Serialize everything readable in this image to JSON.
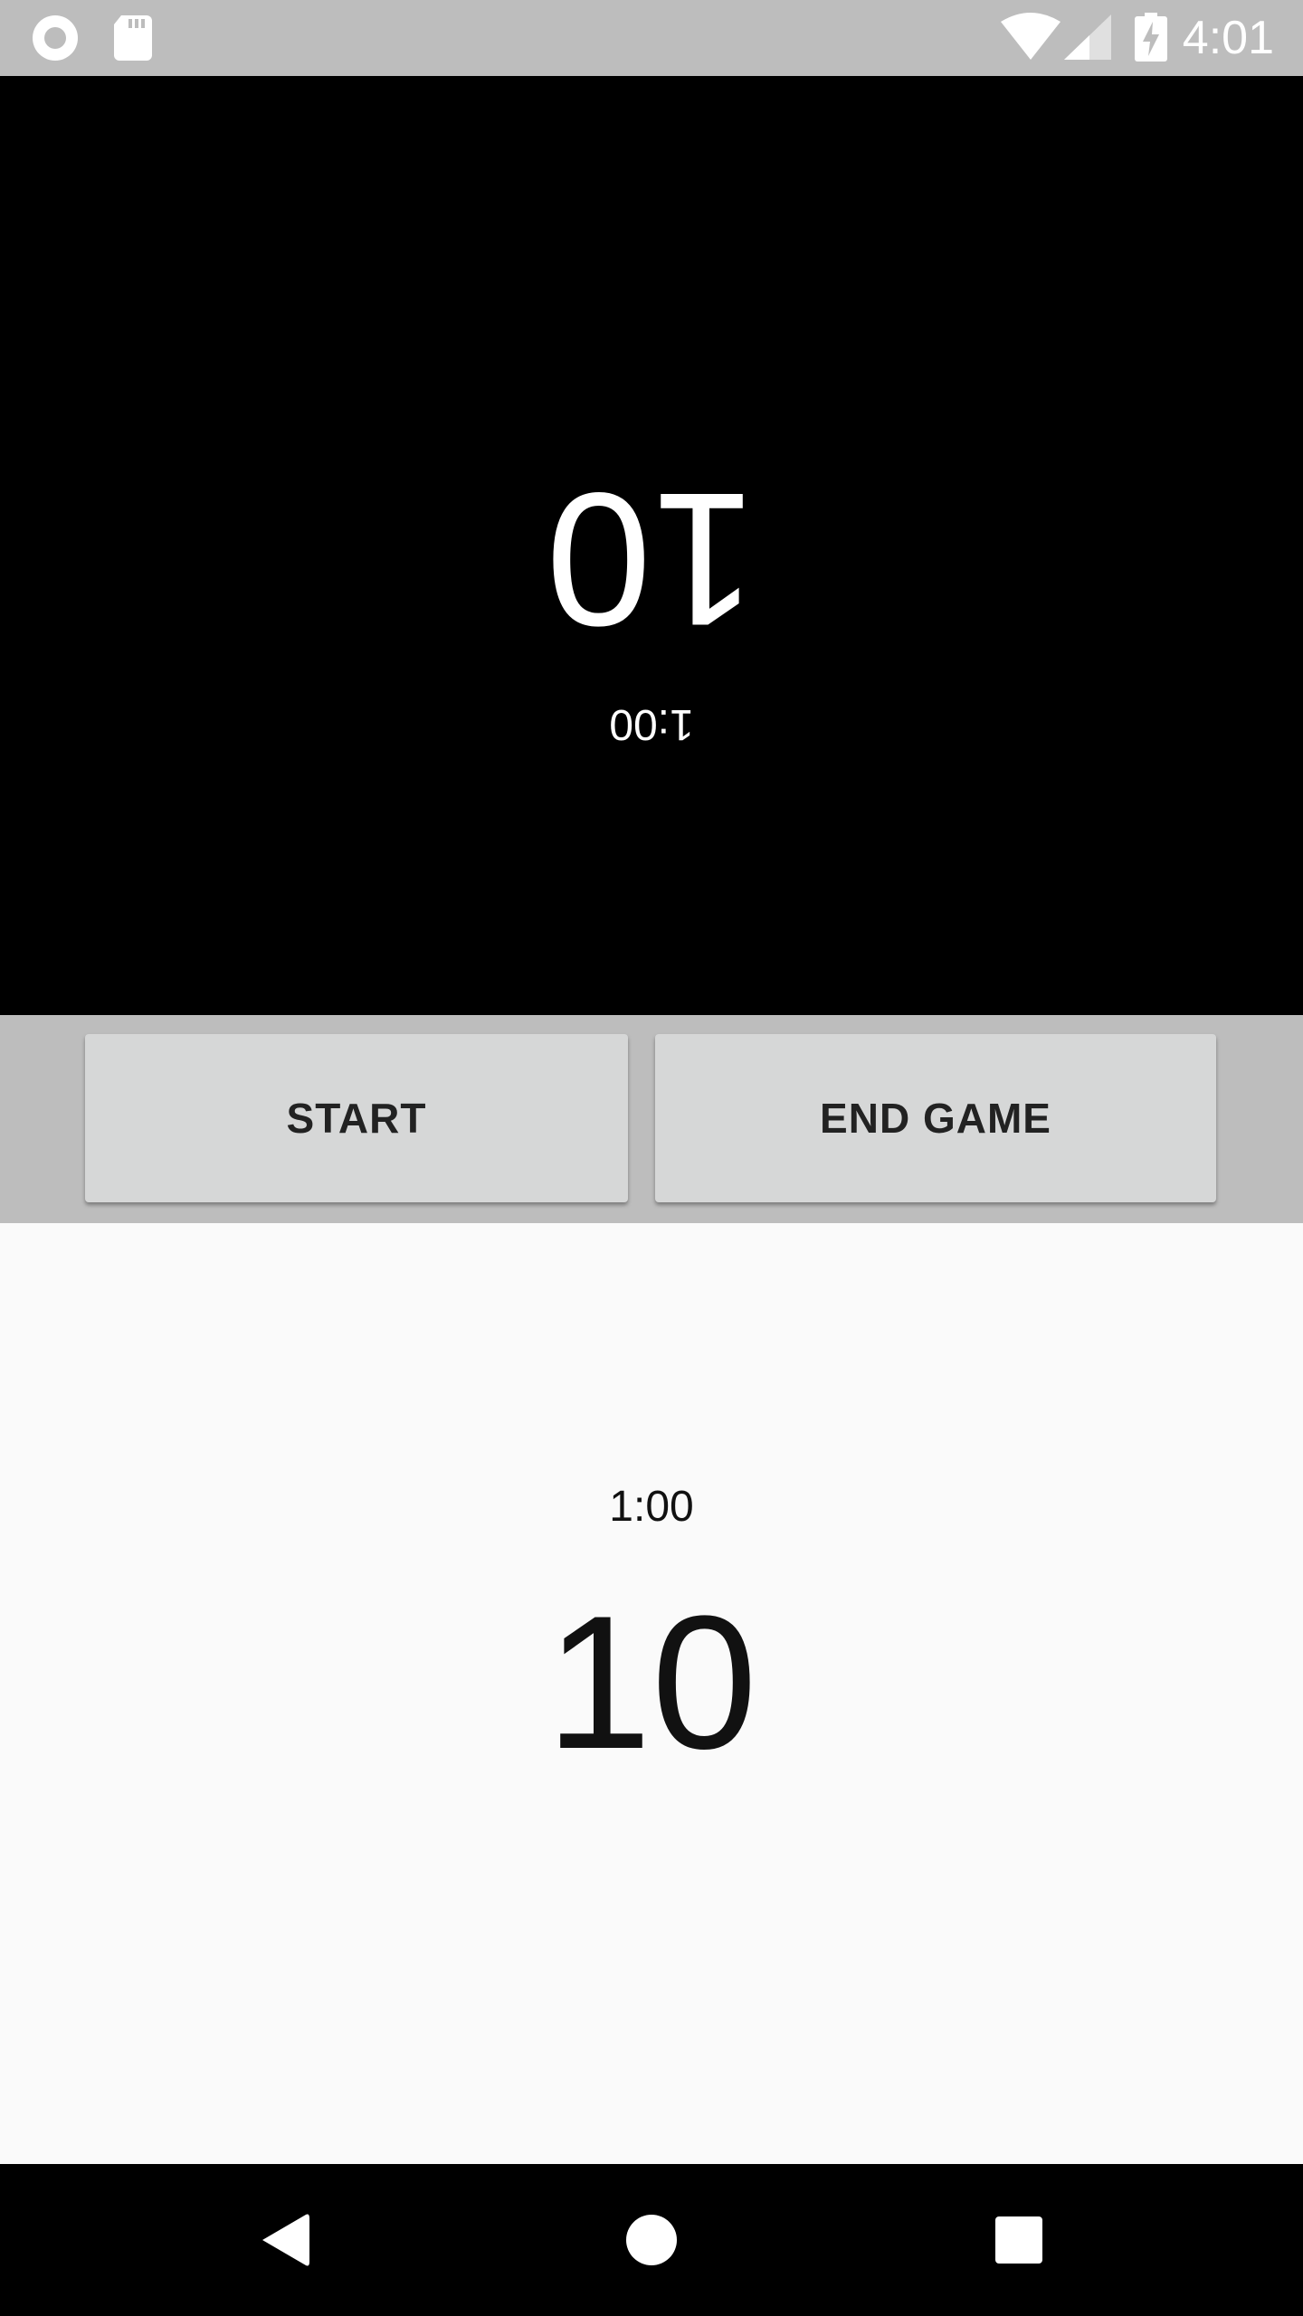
{
  "status_bar": {
    "time": "4:01",
    "icons": [
      "record-icon",
      "sd-card-icon",
      "wifi-icon",
      "signal-icon",
      "battery-charging-icon"
    ]
  },
  "player_top": {
    "score": "10",
    "timer": "1:00"
  },
  "controls": {
    "start_label": "START",
    "end_game_label": "END GAME"
  },
  "player_bottom": {
    "timer": "1:00",
    "score": "10"
  },
  "nav_bar": {
    "icons": [
      "back-icon",
      "home-icon",
      "recents-icon"
    ]
  },
  "colors": {
    "status_bar": "#bdbdbd",
    "top_panel": "#000000",
    "control_bar": "#bdbdbd",
    "button": "#d6d7d7",
    "bottom_panel": "#fafafa",
    "nav_bar": "#000000"
  }
}
